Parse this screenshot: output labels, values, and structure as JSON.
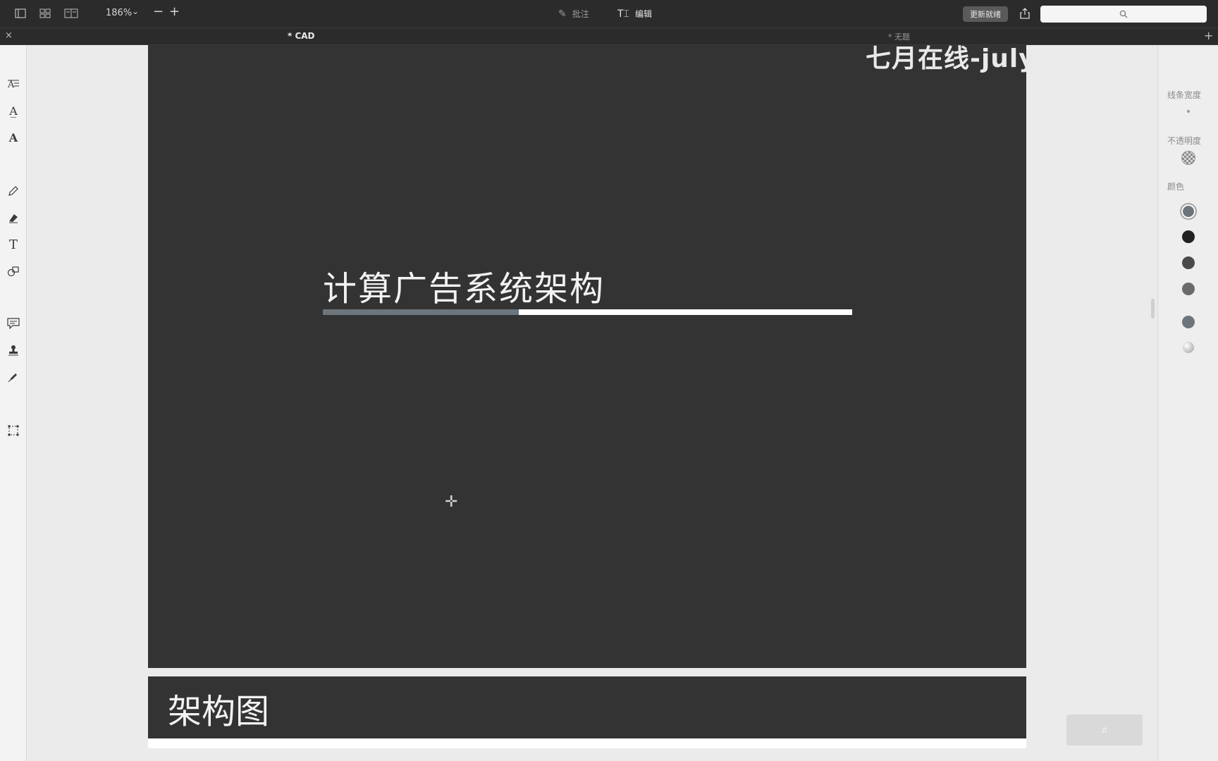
{
  "toolbar": {
    "zoom": "186%",
    "annotate_label": "批注",
    "edit_label": "编辑",
    "update_label": "更新就绪",
    "search_placeholder": ""
  },
  "tabs": {
    "doc_tab": "* CAD",
    "second_tab": "* 无题"
  },
  "slide": {
    "title": "计算广告系统架构",
    "progress_fraction": 0.37,
    "watermark": "七月在线-july"
  },
  "slide2": {
    "title": "架构图"
  },
  "right_panel": {
    "line_width_label": "线条宽度",
    "opacity_label": "不透明度",
    "color_label": "颜色"
  },
  "colors": {
    "background": "#333333",
    "accent": "#6d757c",
    "bar": "#ffffff"
  },
  "icons": {
    "left_tools": [
      "text-select-icon",
      "text-style-icon",
      "text-style-alt-icon",
      "pencil-icon",
      "eraser-icon",
      "text-icon",
      "shapes-icon",
      "comment-icon",
      "stamp-icon",
      "pen-icon",
      "crop-selection-icon"
    ]
  }
}
